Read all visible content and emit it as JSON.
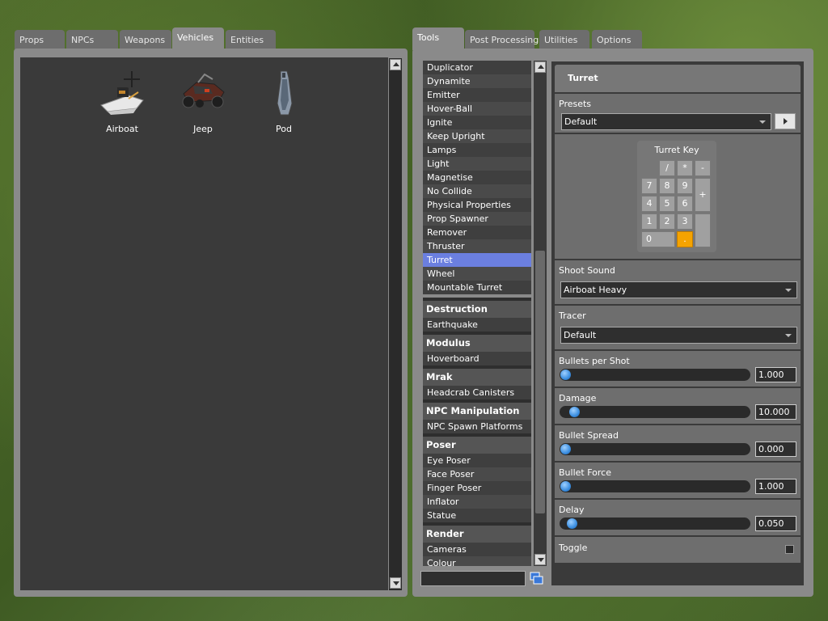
{
  "spawnmenu": {
    "tabs": [
      {
        "label": "Props"
      },
      {
        "label": "NPCs"
      },
      {
        "label": "Weapons"
      },
      {
        "label": "Vehicles"
      },
      {
        "label": "Entities"
      }
    ],
    "active_tab": "Vehicles",
    "vehicles": [
      {
        "label": "Airboat"
      },
      {
        "label": "Jeep"
      },
      {
        "label": "Pod"
      }
    ]
  },
  "toolmenu": {
    "tabs": [
      {
        "label": "Tools"
      },
      {
        "label": "Post Processing"
      },
      {
        "label": "Utilities"
      },
      {
        "label": "Options"
      }
    ],
    "active_tab": "Tools",
    "tools_top": [
      "Duplicator",
      "Dynamite",
      "Emitter",
      "Hover-Ball",
      "Ignite",
      "Keep Upright",
      "Lamps",
      "Light",
      "Magnetise",
      "No Collide",
      "Physical Properties",
      "Prop Spawner",
      "Remover",
      "Thruster",
      "Turret",
      "Wheel",
      "Mountable Turret"
    ],
    "selected_tool": "Turret",
    "categories": [
      {
        "name": "Destruction",
        "items": [
          "Earthquake"
        ]
      },
      {
        "name": "Modulus",
        "items": [
          "Hoverboard"
        ]
      },
      {
        "name": "Mrak",
        "items": [
          "Headcrab Canisters"
        ]
      },
      {
        "name": "NPC Manipulation",
        "items": [
          "NPC Spawn Platforms"
        ]
      },
      {
        "name": "Poser",
        "items": [
          "Eye Poser",
          "Face Poser",
          "Finger Poser",
          "Inflator",
          "Statue"
        ]
      },
      {
        "name": "Render",
        "items": [
          "Cameras",
          "Colour"
        ]
      }
    ],
    "search_value": ""
  },
  "turret": {
    "title": "Turret",
    "presets_label": "Presets",
    "presets_value": "Default",
    "turret_key_label": "Turret Key",
    "keypad": {
      "row0": [
        "/",
        "*",
        "-"
      ],
      "row1": [
        "7",
        "8",
        "9"
      ],
      "row2": [
        "4",
        "5",
        "6"
      ],
      "row3": [
        "1",
        "2",
        "3"
      ],
      "plus": "+",
      "zero": "0",
      "dot": "."
    },
    "selected_key": ".",
    "shoot_sound_label": "Shoot Sound",
    "shoot_sound_value": "Airboat Heavy",
    "tracer_label": "Tracer",
    "tracer_value": "Default",
    "sliders": [
      {
        "label": "Bullets per Shot",
        "value": "1.000",
        "fraction": 0.0
      },
      {
        "label": "Damage",
        "value": "10.000",
        "fraction": 0.05
      },
      {
        "label": "Bullet Spread",
        "value": "0.000",
        "fraction": 0.0
      },
      {
        "label": "Bullet Force",
        "value": "1.000",
        "fraction": 0.0
      },
      {
        "label": "Delay",
        "value": "0.050",
        "fraction": 0.035
      }
    ],
    "toggle_label": "Toggle",
    "toggle_checked": false
  },
  "colors": {
    "selection": "#6b7fe0",
    "selected_key": "#f5a300",
    "slider_knob": "#3b8ee0"
  }
}
